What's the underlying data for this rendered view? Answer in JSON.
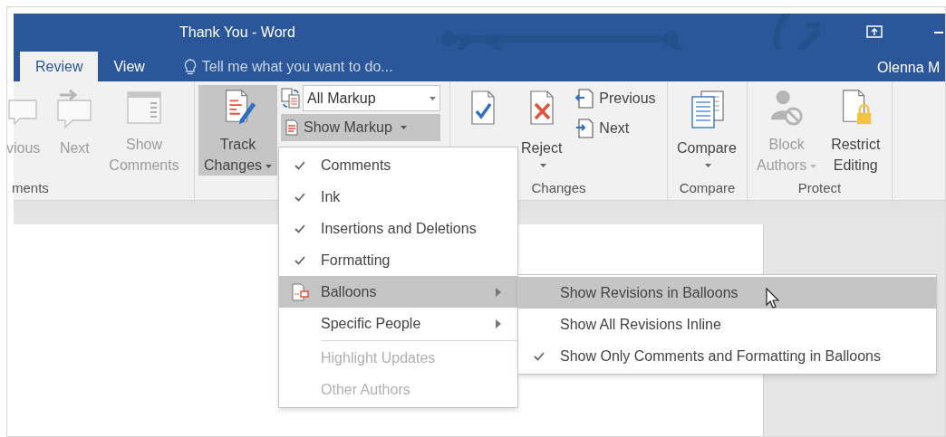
{
  "window": {
    "title": "Thank You - Word",
    "user": "Olenna M"
  },
  "tabs": [
    {
      "label": "Review",
      "selected": true
    },
    {
      "label": "View",
      "selected": false
    }
  ],
  "tell_me": {
    "placeholder": "Tell me what you want to do..."
  },
  "ribbon_groups": [
    {
      "label": "ments",
      "buttons": [
        {
          "kind": "large",
          "label": "vious",
          "disabled": true,
          "pressed": false
        },
        {
          "kind": "large",
          "label": "Next",
          "disabled": true,
          "pressed": false
        },
        {
          "kind": "large",
          "label": "Show Comments",
          "disabled": true,
          "pressed": false
        }
      ]
    },
    {
      "buttons": [
        {
          "kind": "large",
          "label": "Track Changes",
          "dropdown": true,
          "disabled": false,
          "pressed": true
        },
        {
          "kind": "stack",
          "items": [
            {
              "kind": "combo",
              "value": "All Markup"
            },
            {
              "kind": "small",
              "label": "Show Markup",
              "dropdown": true,
              "pressed": true
            }
          ]
        }
      ]
    },
    {
      "label": "Changes",
      "buttons": [
        {
          "kind": "large",
          "pressed": false
        },
        {
          "kind": "large",
          "label": "Reject",
          "dropdown": true,
          "disabled": false,
          "pressed": false
        },
        {
          "kind": "stack",
          "items": [
            {
              "kind": "small",
              "label": "Previous",
              "pressed": false
            },
            {
              "kind": "small",
              "label": "Next",
              "pressed": false
            }
          ]
        }
      ]
    },
    {
      "label": "Compare",
      "buttons": [
        {
          "kind": "large",
          "label": "Compare",
          "dropdown": true,
          "disabled": false,
          "pressed": false
        }
      ]
    },
    {
      "label": "Protect",
      "buttons": [
        {
          "kind": "large",
          "label": "Block Authors",
          "dropdown": true,
          "disabled": true,
          "pressed": false
        },
        {
          "kind": "large",
          "label": "Restrict Editing",
          "disabled": false,
          "pressed": false
        }
      ]
    }
  ],
  "markup_menu": [
    {
      "kind": "check",
      "label": "Comments",
      "checked": true
    },
    {
      "kind": "check",
      "label": "Ink",
      "checked": true
    },
    {
      "kind": "check",
      "label": "Insertions and Deletions",
      "checked": true
    },
    {
      "kind": "check",
      "label": "Formatting",
      "checked": true
    },
    {
      "kind": "submenu",
      "label": "Balloons",
      "icon": true,
      "highlighted": true
    },
    {
      "kind": "submenu",
      "label": "Specific People",
      "icon": false,
      "highlighted": false
    },
    {
      "kind": "separator"
    },
    {
      "kind": "check",
      "label": "Highlight Updates",
      "checked": false,
      "disabled": true
    },
    {
      "kind": "check",
      "label": "Other Authors",
      "checked": false,
      "disabled": true
    }
  ],
  "balloons_menu": [
    {
      "label": "Show Revisions in Balloons",
      "checked": false,
      "highlighted": true
    },
    {
      "label": "Show All Revisions Inline",
      "checked": false,
      "highlighted": false
    },
    {
      "label": "Show Only Comments and Formatting in Balloons",
      "checked": true,
      "highlighted": false
    }
  ]
}
